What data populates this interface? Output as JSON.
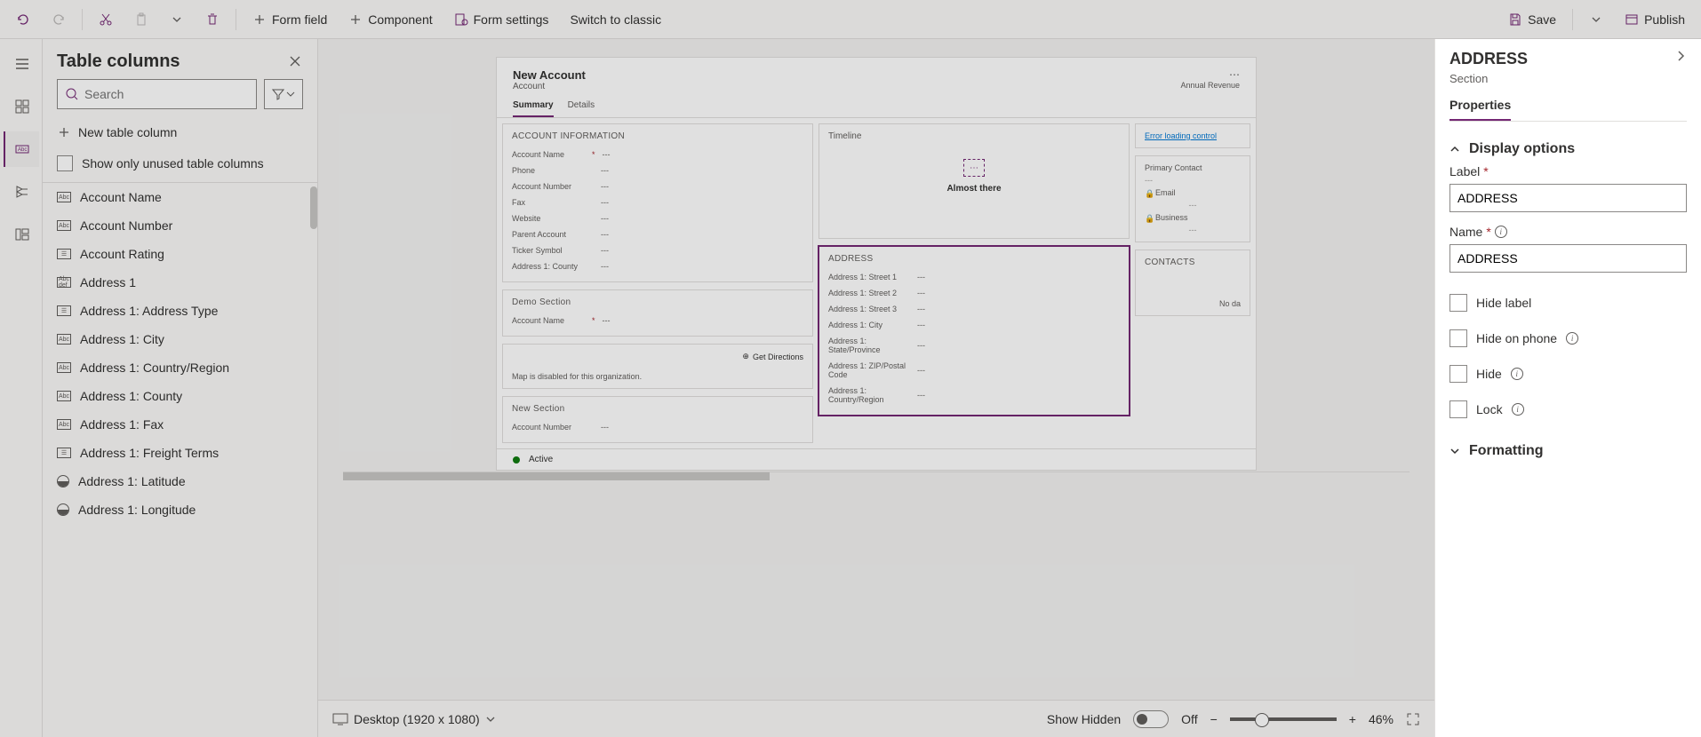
{
  "toolbar": {
    "form_field": "Form field",
    "component": "Component",
    "form_settings": "Form settings",
    "switch_classic": "Switch to classic",
    "save": "Save",
    "publish": "Publish"
  },
  "columns_panel": {
    "title": "Table columns",
    "search_placeholder": "Search",
    "new_column": "New table column",
    "show_unused": "Show only unused table columns",
    "items": [
      {
        "type": "text",
        "label": "Account Name"
      },
      {
        "type": "text",
        "label": "Account Number"
      },
      {
        "type": "option",
        "label": "Account Rating"
      },
      {
        "type": "multi",
        "label": "Address 1"
      },
      {
        "type": "option",
        "label": "Address 1: Address Type"
      },
      {
        "type": "text",
        "label": "Address 1: City"
      },
      {
        "type": "text",
        "label": "Address 1: Country/Region"
      },
      {
        "type": "text",
        "label": "Address 1: County"
      },
      {
        "type": "text",
        "label": "Address 1: Fax"
      },
      {
        "type": "option",
        "label": "Address 1: Freight Terms"
      },
      {
        "type": "float",
        "label": "Address 1: Latitude"
      },
      {
        "type": "float",
        "label": "Address 1: Longitude"
      }
    ]
  },
  "form": {
    "title": "New Account",
    "subtitle": "Account",
    "header_right": "Annual Revenue",
    "tabs": [
      "Summary",
      "Details"
    ],
    "sections": {
      "account_info": {
        "title": "ACCOUNT INFORMATION",
        "fields": [
          {
            "label": "Account Name",
            "required": true,
            "value": "---"
          },
          {
            "label": "Phone",
            "required": false,
            "value": "---"
          },
          {
            "label": "Account Number",
            "required": false,
            "value": "---"
          },
          {
            "label": "Fax",
            "required": false,
            "value": "---"
          },
          {
            "label": "Website",
            "required": false,
            "value": "---"
          },
          {
            "label": "Parent Account",
            "required": false,
            "value": "---"
          },
          {
            "label": "Ticker Symbol",
            "required": false,
            "value": "---"
          },
          {
            "label": "Address 1: County",
            "required": false,
            "value": "---"
          }
        ]
      },
      "demo": {
        "title": "Demo Section",
        "fields": [
          {
            "label": "Account Name",
            "required": true,
            "value": "---"
          }
        ]
      },
      "map": {
        "get_directions": "Get Directions",
        "disabled_msg": "Map is disabled for this organization."
      },
      "new_section": {
        "title": "New Section",
        "fields": [
          {
            "label": "Account Number",
            "required": false,
            "value": "---"
          }
        ]
      },
      "timeline": {
        "title": "Timeline",
        "message": "Almost there"
      },
      "address": {
        "title": "ADDRESS",
        "fields": [
          {
            "label": "Address 1: Street 1",
            "value": "---"
          },
          {
            "label": "Address 1: Street 2",
            "value": "---"
          },
          {
            "label": "Address 1: Street 3",
            "value": "---"
          },
          {
            "label": "Address 1: City",
            "value": "---"
          },
          {
            "label": "Address 1: State/Province",
            "value": "---"
          },
          {
            "label": "Address 1: ZIP/Postal Code",
            "value": "---"
          },
          {
            "label": "Address 1: Country/Region",
            "value": "---"
          }
        ]
      },
      "right_col": {
        "error_link": "Error loading control",
        "primary_contact": "Primary Contact",
        "email": "Email",
        "business": "Business",
        "contacts": "CONTACTS",
        "no_data": "No da"
      }
    },
    "footer_status": "Active"
  },
  "bottom_bar": {
    "viewport": "Desktop (1920 x 1080)",
    "show_hidden": "Show Hidden",
    "toggle_state": "Off",
    "zoom_pct": "46%"
  },
  "props": {
    "title": "ADDRESS",
    "subtitle": "Section",
    "tab": "Properties",
    "display_options": "Display options",
    "label_label": "Label",
    "label_value": "ADDRESS",
    "name_label": "Name",
    "name_value": "ADDRESS",
    "hide_label": "Hide label",
    "hide_on_phone": "Hide on phone",
    "hide": "Hide",
    "lock": "Lock",
    "formatting": "Formatting"
  }
}
